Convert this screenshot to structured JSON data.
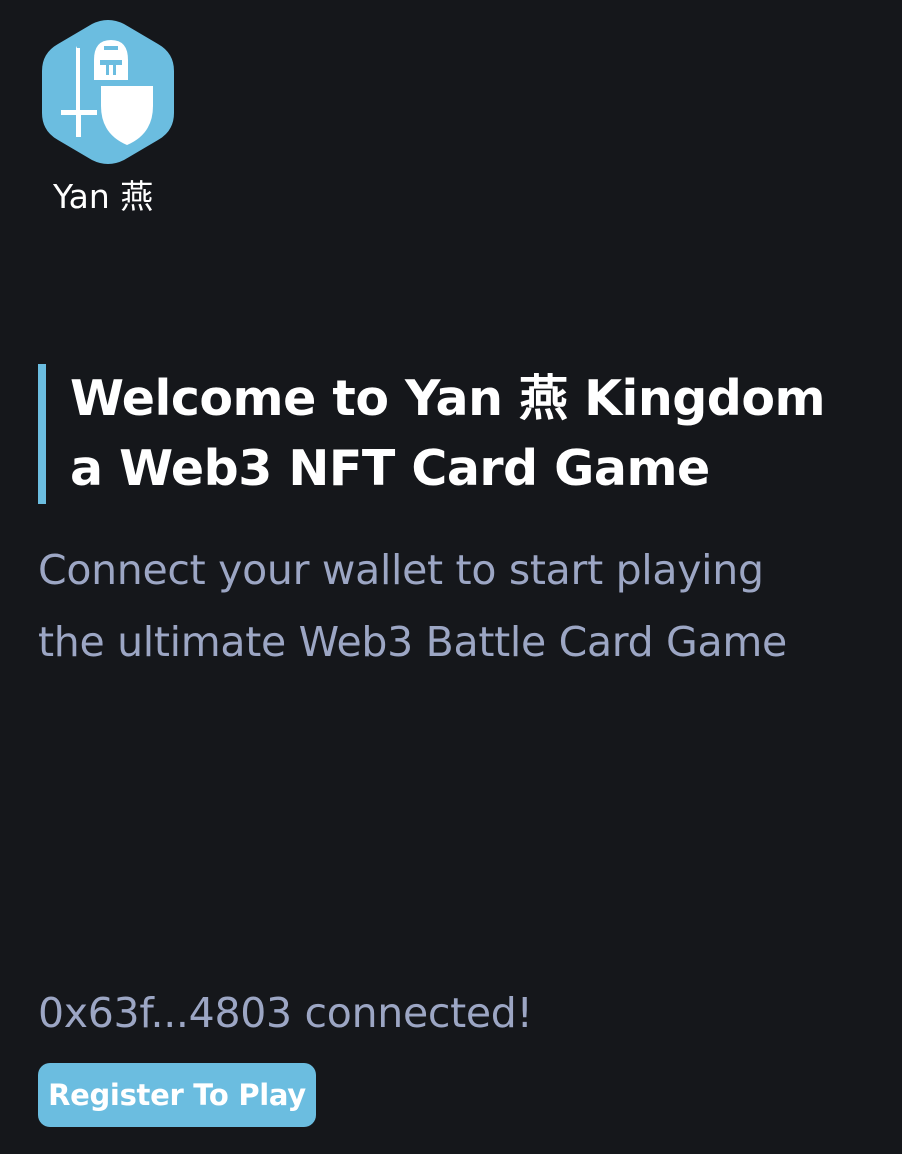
{
  "logo": {
    "icon": "knight-helmet-sword-shield-icon",
    "brand_name": "Yan 燕",
    "color": "#6bbde0"
  },
  "hero": {
    "heading_line1": "Welcome to Yan 燕 Kingdom",
    "heading_line2": "a Web3 NFT Card Game",
    "subtitle_line1": "Connect your wallet to start playing",
    "subtitle_line2": "the ultimate Web3 Battle Card Game"
  },
  "wallet": {
    "status": "0x63f...4803 connected!"
  },
  "actions": {
    "register_label": "Register To Play"
  },
  "colors": {
    "background": "#15171b",
    "accent": "#6bbde0",
    "muted_text": "#9ca6c4",
    "heading_text": "#ffffff"
  }
}
